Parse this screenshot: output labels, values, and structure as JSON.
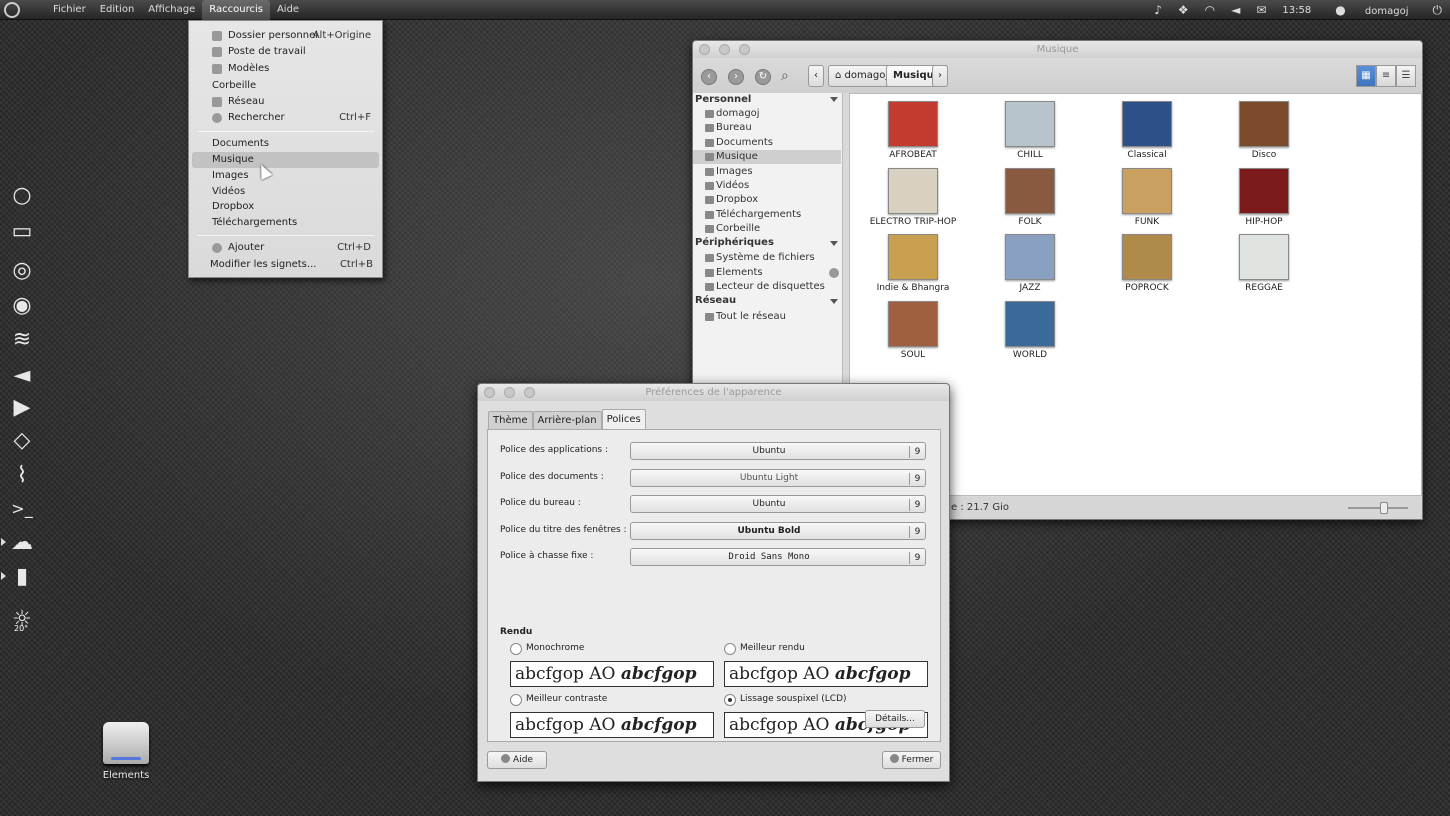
{
  "top_panel": {
    "menus": [
      "Fichier",
      "Edition",
      "Affichage",
      "Raccourcis",
      "Aide"
    ],
    "active_menu": "Raccourcis",
    "clock": "13:58",
    "user": "domagoj"
  },
  "launcher": {
    "icons": [
      "ubuntu-circle-icon",
      "window-icon",
      "chrome-icon",
      "firefox-icon",
      "feather-icon",
      "megaphone-icon",
      "play-icon",
      "box-icon",
      "activity-icon",
      "terminal-icon",
      "server-icon",
      "book-icon",
      "weather-icon"
    ],
    "weather_label": "20°"
  },
  "desktop": {
    "drive_label": "Elements"
  },
  "raccourcis_menu": {
    "items": [
      {
        "label": "Dossier personnel",
        "shortcut": "Alt+Origine",
        "icon": "home-icon"
      },
      {
        "label": "Poste de travail",
        "shortcut": "",
        "icon": "computer-icon"
      },
      {
        "label": "Modèles",
        "shortcut": "",
        "icon": "templates-icon"
      },
      {
        "label": "Corbeille",
        "shortcut": "",
        "icon": ""
      },
      {
        "label": "Réseau",
        "shortcut": "",
        "icon": "network-icon"
      },
      {
        "label": "Rechercher",
        "shortcut": "Ctrl+F",
        "icon": "search-icon"
      }
    ],
    "places": [
      "Documents",
      "Musique",
      "Images",
      "Vidéos",
      "Dropbox",
      "Téléchargements"
    ],
    "highlighted": "Musique",
    "bookmarks": [
      {
        "label": "Ajouter",
        "shortcut": "Ctrl+D"
      },
      {
        "label": "Modifier les signets...",
        "shortcut": "Ctrl+B"
      }
    ]
  },
  "nautilus": {
    "title": "Musique",
    "breadcrumbs": [
      "domagoj",
      "Musique"
    ],
    "sidebar": {
      "personnel_header": "Personnel",
      "personnel_items": [
        "domagoj",
        "Bureau",
        "Documents",
        "Musique",
        "Images",
        "Vidéos",
        "Dropbox",
        "Téléchargements",
        "Corbeille"
      ],
      "selected": "Musique",
      "peripheriques_header": "Périphériques",
      "peripheriques_items": [
        "Système de fichiers",
        "Elements",
        "Lecteur de disquettes"
      ],
      "reseau_header": "Réseau",
      "reseau_items": [
        "Tout le réseau"
      ]
    },
    "folders": [
      {
        "name": "AFROBEAT",
        "color": "#c23b2e"
      },
      {
        "name": "CHILL",
        "color": "#b8c4cc"
      },
      {
        "name": "Classical",
        "color": "#2d4f8a"
      },
      {
        "name": "Disco",
        "color": "#7a4a2a"
      },
      {
        "name": "ELECTRO TRIP-HOP",
        "color": "#d8d0c0"
      },
      {
        "name": "FOLK",
        "color": "#8a5a40"
      },
      {
        "name": "FUNK",
        "color": "#c9a060"
      },
      {
        "name": "HIP-HOP",
        "color": "#7a1a1a"
      },
      {
        "name": "Indie & Bhangra",
        "color": "#c8a050"
      },
      {
        "name": "JAZZ",
        "color": "#8aa0c0"
      },
      {
        "name": "POPROCK",
        "color": "#b08a4a"
      },
      {
        "name": "REGGAE",
        "color": "#e0e4e0"
      },
      {
        "name": "SOUL",
        "color": "#a06040"
      },
      {
        "name": "WORLD",
        "color": "#3a6a9a"
      }
    ],
    "status": "e : 21.7 Gio",
    "zoom_level": 0.6
  },
  "appearance": {
    "title": "Préférences de l'apparence",
    "tabs": [
      "Thème",
      "Arrière-plan",
      "Polices"
    ],
    "active_tab": "Polices",
    "fonts": [
      {
        "label": "Police des applications :",
        "font": "Ubuntu",
        "size": "9",
        "style": "normal"
      },
      {
        "label": "Police des documents :",
        "font": "Ubuntu Light",
        "size": "9",
        "style": "light"
      },
      {
        "label": "Police du bureau :",
        "font": "Ubuntu",
        "size": "9",
        "style": "normal"
      },
      {
        "label": "Police du titre des fenêtres :",
        "font": "Ubuntu Bold",
        "size": "9",
        "style": "bold"
      },
      {
        "label": "Police à chasse fixe :",
        "font": "Droid Sans Mono",
        "size": "9",
        "style": "mono"
      }
    ],
    "rendu_header": "Rendu",
    "rendering": [
      {
        "label": "Monochrome",
        "selected": false
      },
      {
        "label": "Meilleur rendu",
        "selected": false
      },
      {
        "label": "Meilleur contraste",
        "selected": false
      },
      {
        "label": "Lissage souspixel (LCD)",
        "selected": true
      }
    ],
    "sample_text": "abcfgop AO",
    "sample_italic": "abcfgop",
    "details_button": "Détails...",
    "help_button": "Aide",
    "close_button": "Fermer"
  }
}
